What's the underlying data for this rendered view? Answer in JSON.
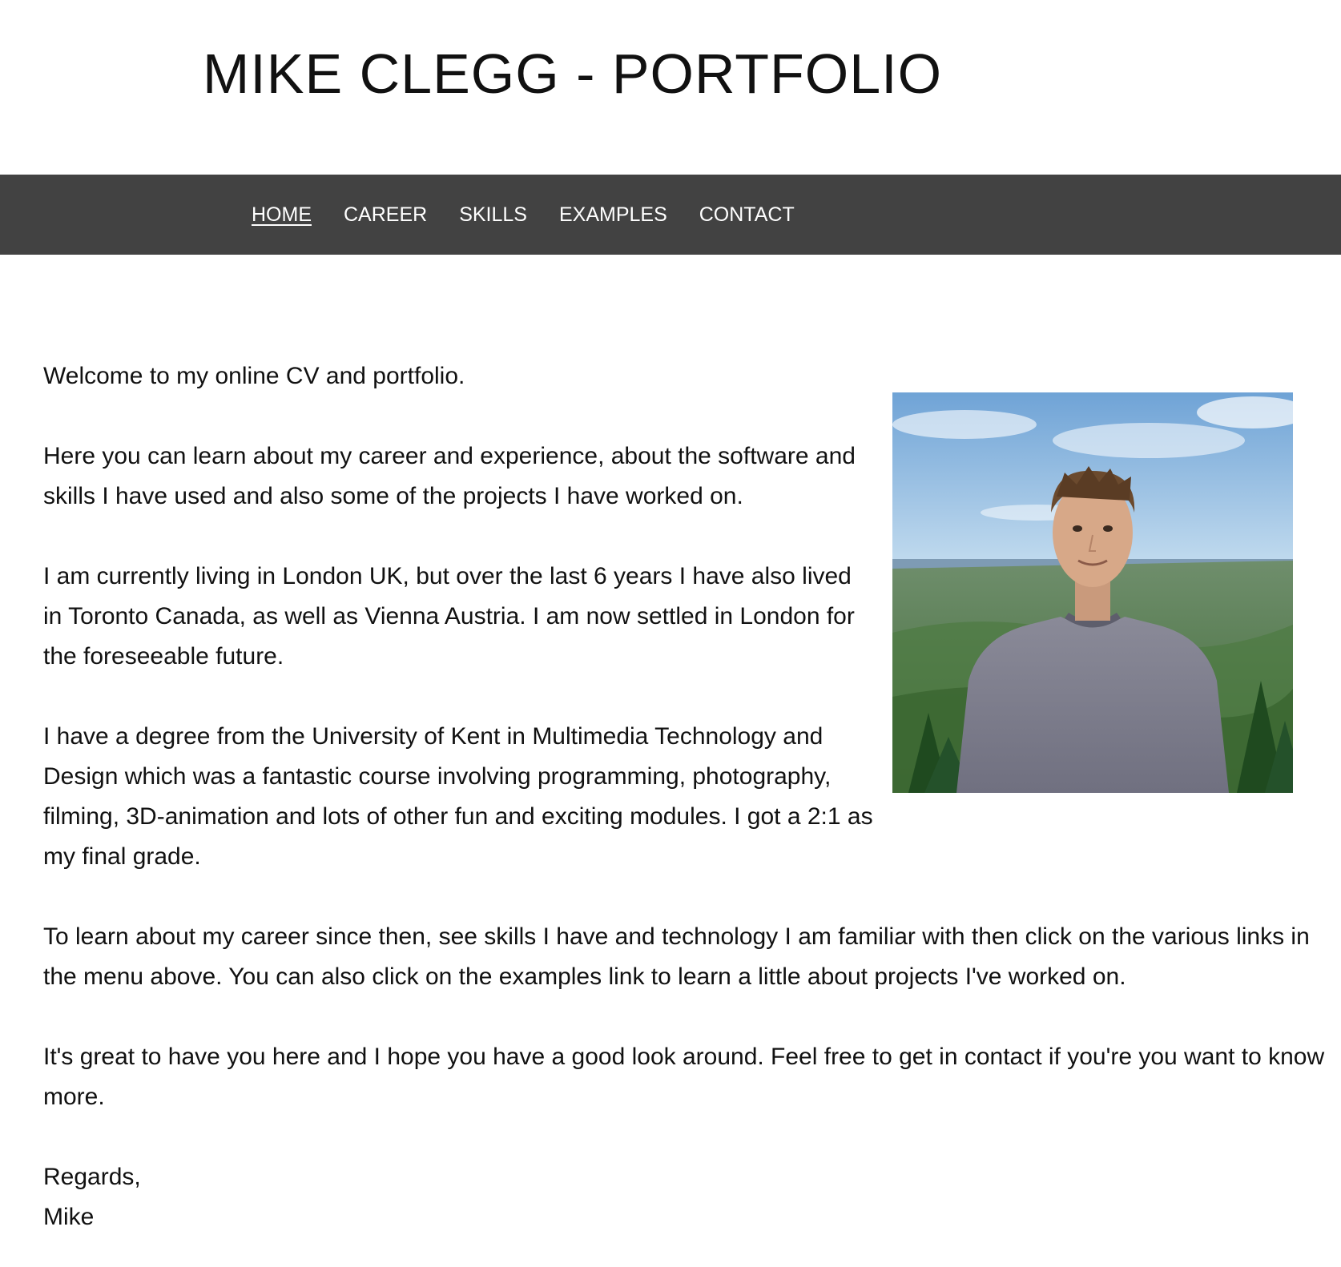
{
  "header": {
    "title": "MIKE CLEGG - PORTFOLIO"
  },
  "nav": {
    "items": [
      {
        "label": "HOME",
        "active": true
      },
      {
        "label": "CAREER",
        "active": false
      },
      {
        "label": "SKILLS",
        "active": false
      },
      {
        "label": "EXAMPLES",
        "active": false
      },
      {
        "label": "CONTACT",
        "active": false
      }
    ]
  },
  "main": {
    "paragraphs": [
      "Welcome to my online CV and portfolio.",
      "Here you can learn about my career and experience, about the software and skills I have used and also some of the projects I have worked on.",
      "I am currently living in London UK, but over the last 6 years I have also lived in Toronto Canada, as well as Vienna Austria. I am now settled in London for the foreseeable future.",
      "I have a degree from the University of Kent in Multimedia Technology and Design which was a fantastic course involving programming, photography, filming, 3D-animation and lots of other fun and exciting modules. I got a 2:1 as my final grade.",
      "To learn about my career since then, see skills I have and technology I am familiar with then click on the various links in the menu above. You can also click on the examples link to learn a little about projects I've worked on.",
      "It's great to have you here and I hope you have a good look around. Feel free to get in contact if you're you want to know more."
    ],
    "sign_off": {
      "greeting": "Regards,",
      "name": "Mike"
    }
  },
  "colors": {
    "nav_background": "#424242",
    "nav_text": "#ffffff",
    "body_text": "#111111"
  }
}
